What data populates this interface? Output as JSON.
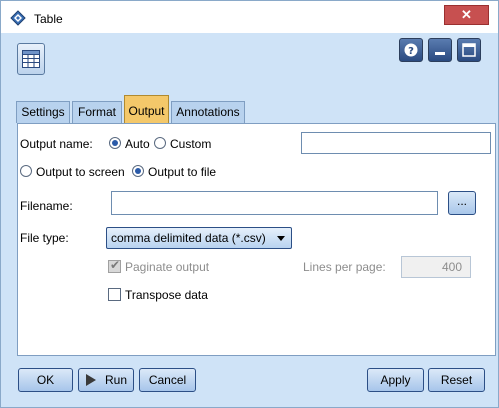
{
  "window": {
    "title": "Table",
    "close_glyph": "✕"
  },
  "tabs": [
    {
      "label": "Settings"
    },
    {
      "label": "Format"
    },
    {
      "label": "Output"
    },
    {
      "label": "Annotations"
    }
  ],
  "output": {
    "output_name_label": "Output name:",
    "auto_label": "Auto",
    "custom_label": "Custom",
    "output_name_mode": "Auto",
    "custom_value": "",
    "to_screen_label": "Output to screen",
    "to_file_label": "Output to file",
    "output_destination": "Output to file",
    "filename_label": "Filename:",
    "filename_value": "",
    "browse_label": "...",
    "file_type_label": "File type:",
    "file_type_value": "comma delimited data (*.csv)",
    "paginate_label": "Paginate output",
    "paginate_checked": true,
    "lines_per_page_label": "Lines per page:",
    "lines_per_page_value": "400",
    "transpose_label": "Transpose data",
    "transpose_checked": false
  },
  "buttons": {
    "ok": "OK",
    "run": "Run",
    "cancel": "Cancel",
    "apply": "Apply",
    "reset": "Reset"
  },
  "icons": {
    "app": "spss-modeler-diamond-icon",
    "node": "table-node-icon",
    "help": "help-icon",
    "minimize": "minimize-icon",
    "maximize": "maximize-icon",
    "run": "play-icon"
  },
  "colors": {
    "accent_tab": "#f4c86a",
    "dialog_bg": "#cfe3f7",
    "close_button": "#c75050"
  }
}
